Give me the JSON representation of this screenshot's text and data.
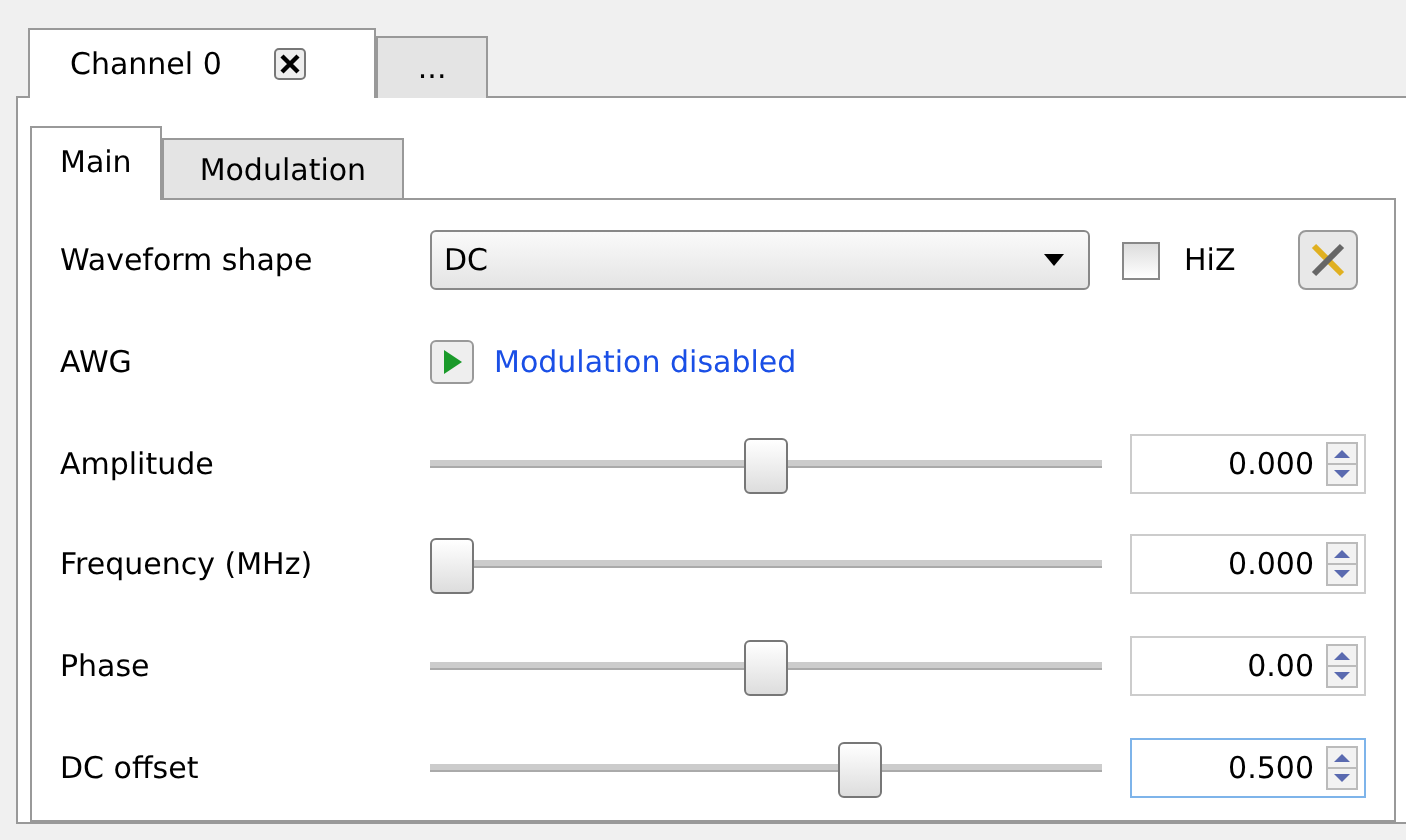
{
  "outer_tabs": [
    {
      "label": "Channel 0",
      "selected": true,
      "closable": true
    },
    {
      "label": "...",
      "selected": false,
      "closable": false
    }
  ],
  "inner_tabs": [
    {
      "label": "Main",
      "selected": true
    },
    {
      "label": "Modulation",
      "selected": false
    }
  ],
  "waveform": {
    "label": "Waveform shape",
    "value": "DC",
    "hiz_label": "HiZ",
    "hiz_checked": false
  },
  "awg": {
    "label": "AWG",
    "link": "Modulation disabled"
  },
  "sliders": [
    {
      "label": "Amplitude",
      "level": 0.5,
      "value": "0.000",
      "focused": false
    },
    {
      "label": "Frequency (MHz)",
      "level": 0,
      "value": "0.000",
      "focused": false
    },
    {
      "label": "Phase",
      "level": 0.5,
      "value": "0.00",
      "focused": false
    },
    {
      "label": "DC offset",
      "level": 0.65,
      "value": "0.500",
      "focused": true
    }
  ]
}
